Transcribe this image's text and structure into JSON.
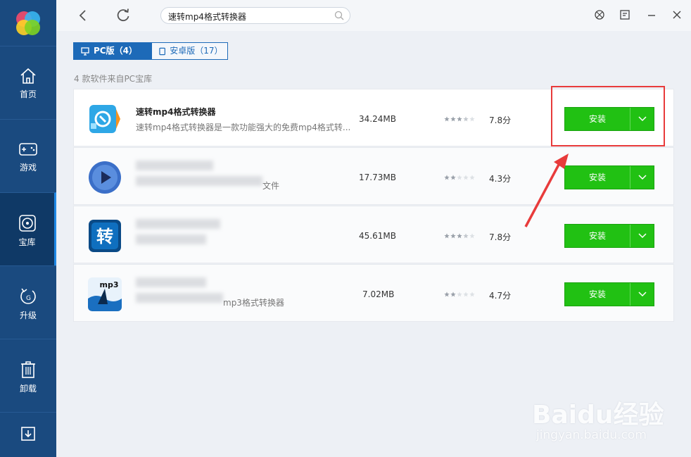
{
  "nav": [
    {
      "label": "首页",
      "icon": "home-icon"
    },
    {
      "label": "游戏",
      "icon": "gamepad-icon"
    },
    {
      "label": "宝库",
      "icon": "treasury-icon"
    },
    {
      "label": "升级",
      "icon": "upgrade-icon"
    },
    {
      "label": "卸载",
      "icon": "trash-icon"
    },
    {
      "label": "",
      "icon": "download-icon"
    }
  ],
  "search": {
    "query": "速转mp4格式转换器"
  },
  "tabs": [
    {
      "label": "PC版（4）",
      "icon": "monitor-icon"
    },
    {
      "label": "安卓版（17）",
      "icon": "phone-icon"
    }
  ],
  "info": "4 款软件来自PC宝库",
  "apps": [
    {
      "name": "速转mp4格式转换器",
      "desc": "速转mp4格式转换器是一款功能强大的免费mp4格式转...",
      "size": "34.24MB",
      "rating": 3.5,
      "score": "7.8分",
      "install": "安装"
    },
    {
      "name": "",
      "desc": "文件",
      "size": "17.73MB",
      "rating": 2,
      "score": "4.3分",
      "install": "安装"
    },
    {
      "name": "",
      "desc": "",
      "size": "45.61MB",
      "rating": 3.5,
      "score": "7.8分",
      "install": "安装"
    },
    {
      "name": "",
      "desc": "mp3格式转换器",
      "size": "7.02MB",
      "rating": 2,
      "score": "4.7分",
      "install": "安装"
    }
  ],
  "icon_texts": {
    "app3": "转",
    "app4": "mp3"
  },
  "watermark": {
    "main": "Baidu经验",
    "sub": "jingyan.baidu.com"
  },
  "colors": {
    "sidebar": "#1a4a7f",
    "accent": "#1d6ab8",
    "install": "#21c113",
    "annotation": "#e83b3b"
  }
}
